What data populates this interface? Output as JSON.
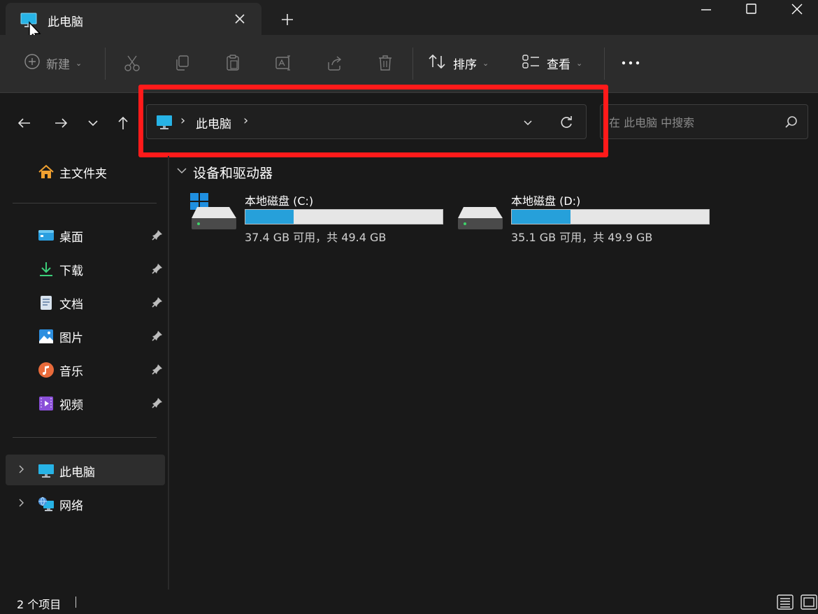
{
  "tab": {
    "title": "此电脑"
  },
  "toolbar": {
    "new_label": "新建",
    "sort_label": "排序",
    "view_label": "查看"
  },
  "address": {
    "crumb": "此电脑"
  },
  "search": {
    "placeholder": "在 此电脑 中搜索"
  },
  "sidebar": {
    "home": "主文件夹",
    "quick_access": [
      {
        "label": "桌面",
        "icon": "desktop-icon"
      },
      {
        "label": "下载",
        "icon": "download-icon"
      },
      {
        "label": "文档",
        "icon": "documents-icon"
      },
      {
        "label": "图片",
        "icon": "pictures-icon"
      },
      {
        "label": "音乐",
        "icon": "music-icon"
      },
      {
        "label": "视频",
        "icon": "videos-icon"
      }
    ],
    "this_pc": "此电脑",
    "network": "网络"
  },
  "content": {
    "group_title": "设备和驱动器",
    "drives": [
      {
        "name": "本地磁盘 (C:)",
        "info": "37.4 GB 可用，共 49.4 GB",
        "used_fraction": 0.243
      },
      {
        "name": "本地磁盘 (D:)",
        "info": "35.1 GB 可用，共 49.9 GB",
        "used_fraction": 0.297
      }
    ]
  },
  "status": {
    "item_count": "2 个项目"
  },
  "colors": {
    "accent": "#26a0da",
    "highlight_box": "#ff1a1a",
    "window_bg": "#191919",
    "toolbar_bg": "#2c2c2c"
  }
}
